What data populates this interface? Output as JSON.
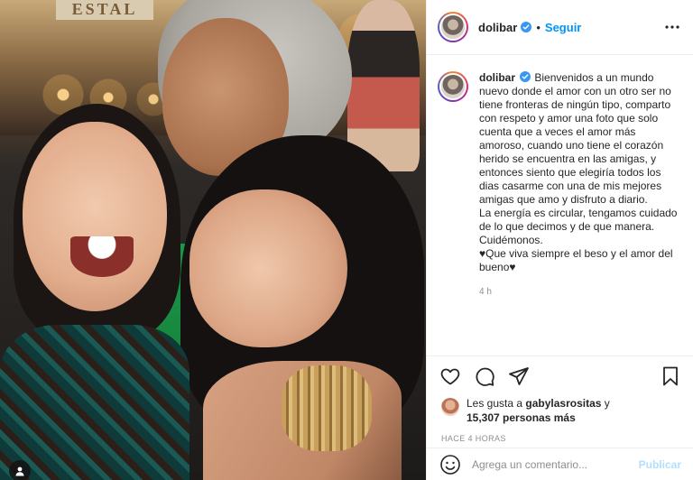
{
  "post": {
    "photo_alt": "Tres mujeres riendo abrazadas de noche",
    "sign_text": "ESTAL"
  },
  "header": {
    "username": "dolibar",
    "separator": "•",
    "follow_label": "Seguir"
  },
  "caption": {
    "username": "dolibar",
    "paragraphs": [
      "Bienvenidos a un mundo nuevo donde el amor con un otro ser no tiene fronteras de ningún tipo, comparto con respeto y amor una foto que solo cuenta que a veces el amor más amoroso, cuando uno tiene el corazón herido se encuentra en las amigas, y entonces siento que elegiría todos los dias casarme con una de mis mejores amigas que amo y disfruto a diario.",
      "La energía es circular, tengamos cuidado de lo que decimos y de que manera. Cuidémonos.",
      "♥Que viva siempre el beso y el amor del bueno♥"
    ],
    "time": "4 h"
  },
  "likes": {
    "prefix": "Les gusta a ",
    "user": "gabylasrositas",
    "joiner": " y",
    "count": "15,307 personas más"
  },
  "timeago": "HACE 4 HORAS",
  "comment": {
    "placeholder": "Agrega un comentario...",
    "post_label": "Publicar"
  },
  "colors": {
    "accent": "#0095f6",
    "post_disabled": "#b2dffc",
    "verified": "#3897f0",
    "muted": "#8e8e8e"
  }
}
